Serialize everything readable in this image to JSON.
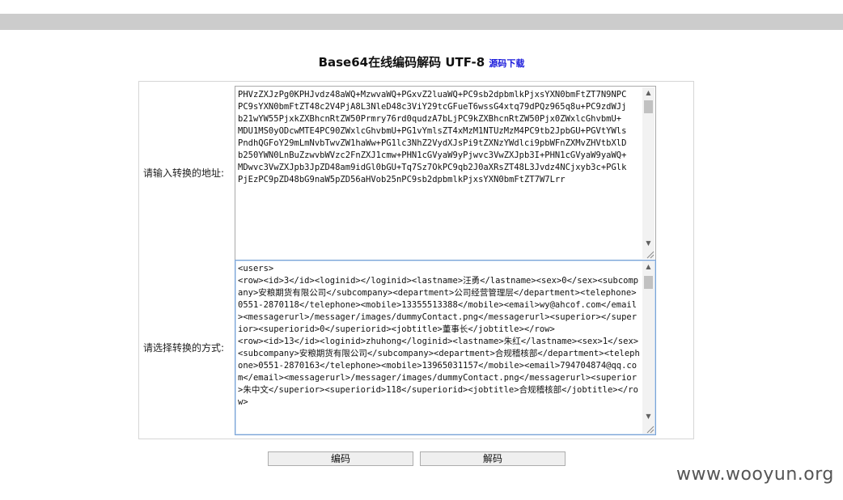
{
  "header": {
    "title": "Base64在线编码解码 UTF-8",
    "source_link": "源码下载"
  },
  "form": {
    "input_label": "请输入转换的地址:",
    "input_value": "PHVzZXJzPg0KPHJvdz48aWQ+MzwvaWQ+PGxvZ2luaWQ+PC9sb2dpbmlkPjxsYXN0bmFtZT7N9NPC\nPC9sYXN0bmFtZT48c2V4PjA8L3NleD48c3ViY29tcGFueT6wssG4xtq79dPQz965q8u+PC9zdWJj\nb21wYW55PjxkZXBhcnRtZW50Prmry76rd0qudzA7bLjPC9kZXBhcnRtZW50Pjx0ZWxlcGhvbmU+\nMDU1MS0yODcwMTE4PC90ZWxlcGhvbmU+PG1vYmlsZT4xMzM1NTUzMzM4PC9tb2JpbGU+PGVtYWls\nPndhQGFoY29mLmNvbTwvZW1haWw+PG1lc3NhZ2VydXJsPi9tZXNzYWdlci9pbWFnZXMvZHVtbXlD\nb250YWN0LnBuZzwvbWVzc2FnZXJ1cmw+PHN1cGVyaW9yPjwvc3VwZXJpb3I+PHN1cGVyaW9yaWQ+\nMDwvc3VwZXJpb3JpZD48am9idGl0bGU+Tq7Sz7OkPC9qb2J0aXRsZT48L3Jvdz4NCjxyb3c+PGlk\nPjEzPC9pZD48bG9naW5pZD56aHVob25nPC9sb2dpbmlkPjxsYXN0bmFtZT7W7Lrr",
    "method_label": "请选择转换的方式:",
    "output_value": "<users>\n<row><id>3</id><loginid></loginid><lastname>汪勇</lastname><sex>0</sex><subcompany>安粮期货有限公司</subcompany><department>公司经营管理层</department><telephone>0551-2870118</telephone><mobile>13355513388</mobile><email>wy@ahcof.com</email><messagerurl>/messager/images/dummyContact.png</messagerurl><superior></superior><superiorid>0</superiorid><jobtitle>董事长</jobtitle></row>\n<row><id>13</id><loginid>zhuhong</loginid><lastname>朱红</lastname><sex>1</sex><subcompany>安粮期货有限公司</subcompany><department>合规稽核部</department><telephone>0551-2870163</telephone><mobile>13965031157</mobile><email>794704874@qq.com</email><messagerurl>/messager/images/dummyContact.png</messagerurl><superior>朱中文</superior><superiorid>118</superiorid><jobtitle>合规稽核部</jobtitle></row>"
  },
  "buttons": {
    "encode": "编码",
    "decode": "解码"
  },
  "watermark": "www.wooyun.org"
}
